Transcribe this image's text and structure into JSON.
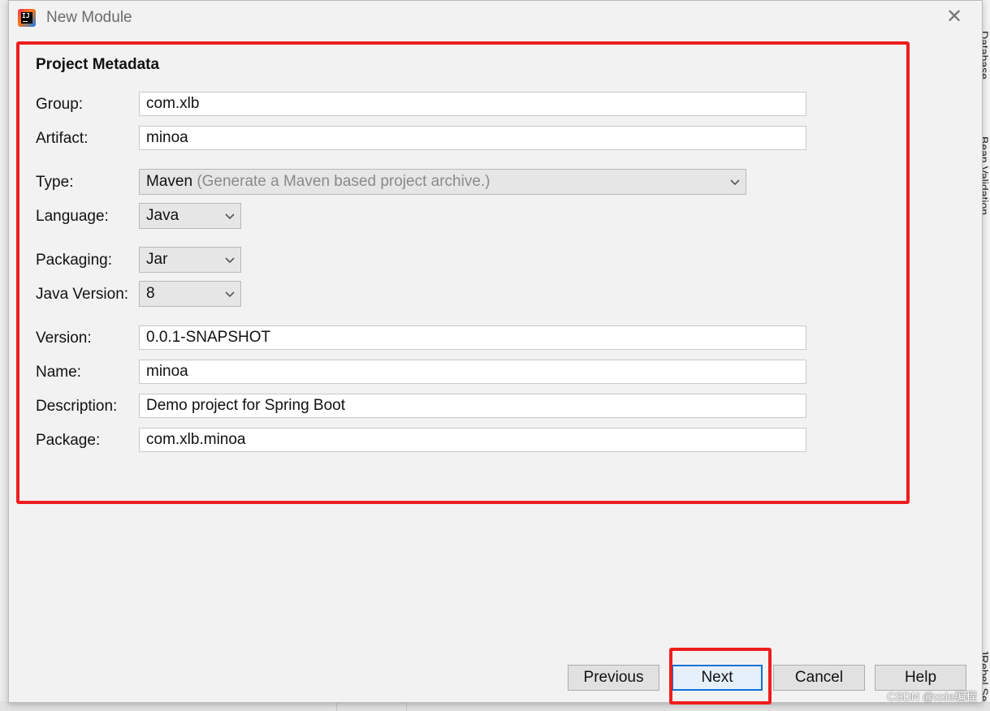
{
  "window": {
    "title": "New Module",
    "close_glyph": "✕"
  },
  "section_title": "Project Metadata",
  "fields": {
    "group": {
      "label": "Group:",
      "value": "com.xlb"
    },
    "artifact": {
      "label": "Artifact:",
      "value": "minoa"
    },
    "type": {
      "label": "Type:",
      "value": "Maven",
      "hint": "(Generate a Maven based project archive.)"
    },
    "language": {
      "label": "Language:",
      "value": "Java"
    },
    "packaging": {
      "label": "Packaging:",
      "value": "Jar"
    },
    "java_version": {
      "label": "Java Version:",
      "value": "8"
    },
    "version": {
      "label": "Version:",
      "value": "0.0.1-SNAPSHOT"
    },
    "name": {
      "label": "Name:",
      "value": "minoa"
    },
    "description": {
      "label": "Description:",
      "value": "Demo project for Spring Boot"
    },
    "package": {
      "label": "Package:",
      "value": "com.xlb.minoa"
    }
  },
  "buttons": {
    "previous": "Previous",
    "next": "Next",
    "cancel": "Cancel",
    "help": "Help"
  },
  "side_tabs": {
    "database": "Database",
    "bean_validation": "Bean Validation",
    "jrebel": "JRebel Se"
  },
  "watermark": "CSDN @xxie编程",
  "colors": {
    "annotation_red": "#ee1d1d",
    "focus_blue": "#0a72d6"
  }
}
